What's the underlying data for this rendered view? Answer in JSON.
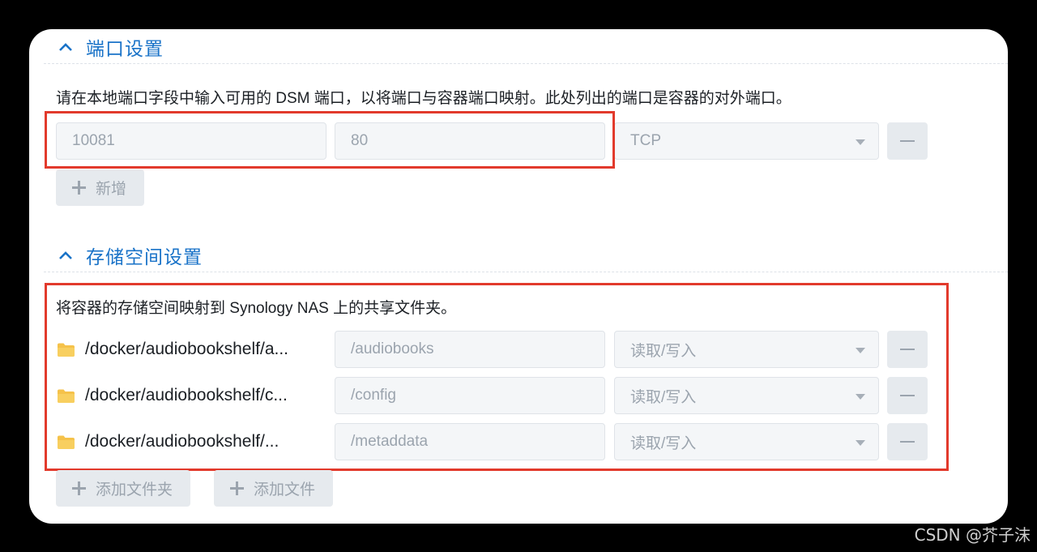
{
  "port_section": {
    "title": "端口设置",
    "description": "请在本地端口字段中输入可用的 DSM 端口，以将端口与容器端口映射。此处列出的端口是容器的对外端口。",
    "row": {
      "local_port": "10081",
      "container_port": "80",
      "protocol": "TCP"
    },
    "add_label": "新增"
  },
  "storage_section": {
    "title": "存储空间设置",
    "description": "将容器的存储空间映射到 Synology NAS 上的共享文件夹。",
    "rows": [
      {
        "folder": "/docker/audiobookshelf/a...",
        "mount_path": "/audiobooks",
        "permission": "读取/写入"
      },
      {
        "folder": "/docker/audiobookshelf/c...",
        "mount_path": "/config",
        "permission": "读取/写入"
      },
      {
        "folder": "/docker/audiobookshelf/...",
        "mount_path": "/metaddata",
        "permission": "读取/写入"
      }
    ],
    "add_folder_label": "添加文件夹",
    "add_file_label": "添加文件"
  },
  "watermark": "CSDN @芥子沫",
  "colors": {
    "section_title": "#1a73c8",
    "highlight": "#e23a2c",
    "folder": "#f5c24a"
  }
}
